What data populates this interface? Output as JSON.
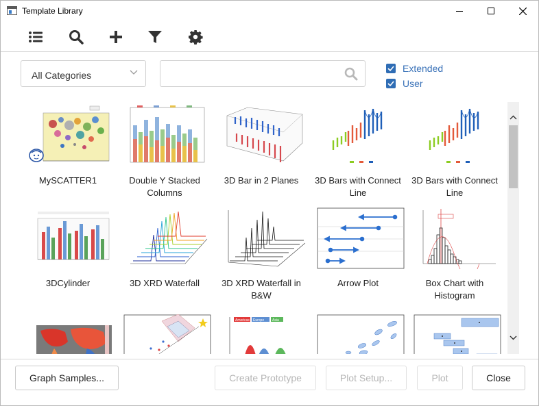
{
  "window": {
    "title": "Template Library"
  },
  "toolbar": {
    "items": [
      "list-icon",
      "search-icon",
      "add-icon",
      "filter-icon",
      "gear-icon"
    ]
  },
  "filters": {
    "category": "All Categories",
    "search_value": "",
    "checkboxes": [
      {
        "label": "Extended",
        "checked": true
      },
      {
        "label": "User",
        "checked": true
      }
    ]
  },
  "templates": [
    {
      "label": "MySCATTER1"
    },
    {
      "label": "Double Y Stacked Columns"
    },
    {
      "label": "3D Bar in 2 Planes"
    },
    {
      "label": "3D Bars with Connect Line"
    },
    {
      "label": "3D Bars with Connect Line"
    },
    {
      "label": "3DCylinder"
    },
    {
      "label": "3D XRD Waterfall"
    },
    {
      "label": "3D XRD Waterfall in B&W"
    },
    {
      "label": "Arrow Plot"
    },
    {
      "label": "Box Chart with Histogram"
    }
  ],
  "thumb_texts": {
    "legend_americas": "Americas",
    "legend_europe": "Europe",
    "legend_asia": "Asia"
  },
  "footer": {
    "graph_samples": "Graph Samples...",
    "create_prototype": "Create Prototype",
    "plot_setup": "Plot Setup...",
    "plot": "Plot",
    "close": "Close"
  },
  "colors": {
    "accent": "#2f6db5",
    "checkbox_label": "#3a72b8",
    "disabled_text": "#b6b6b6"
  }
}
